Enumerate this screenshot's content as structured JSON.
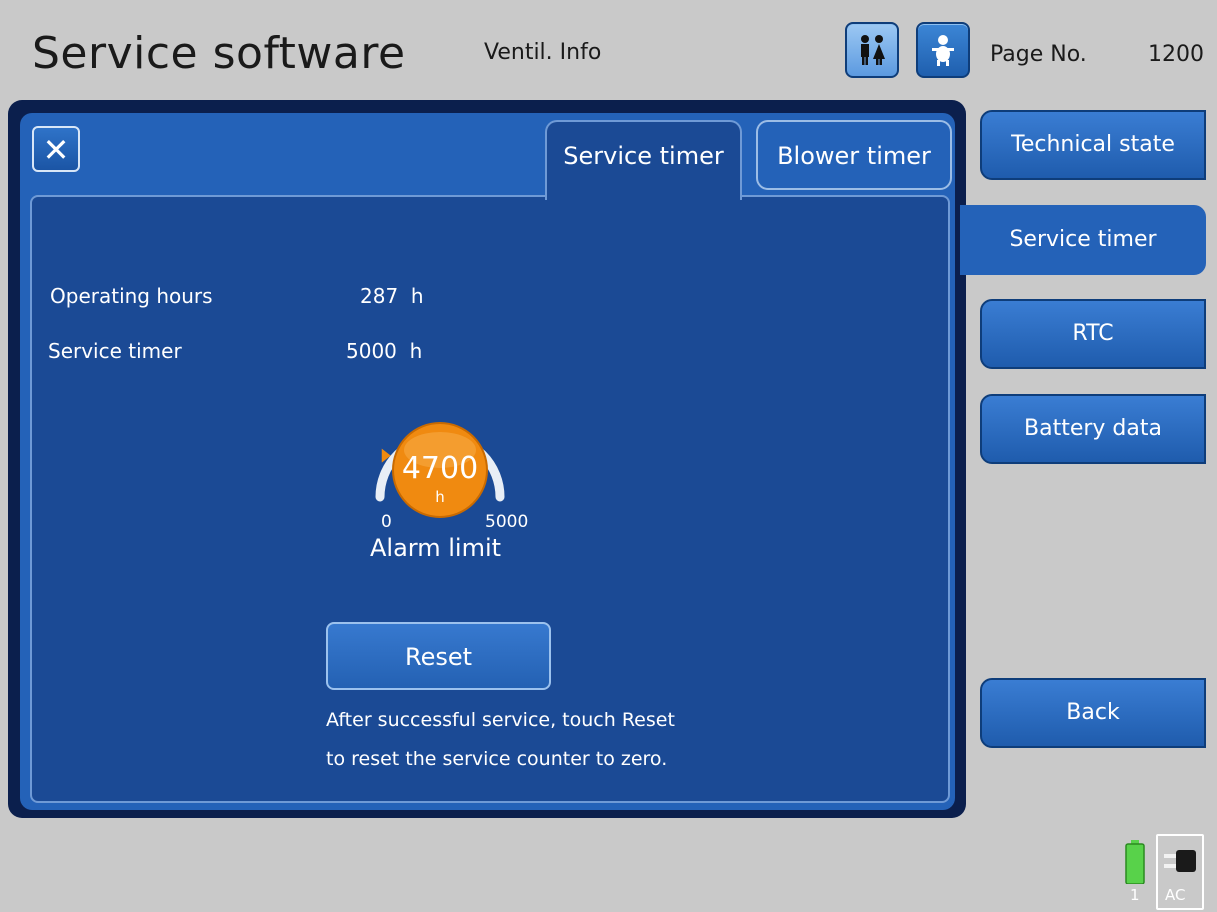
{
  "header": {
    "title": "Service software",
    "screen": "Ventil. Info",
    "page_no_label": "Page No.",
    "page_no_value": "1200",
    "mode_icons": [
      "adult-patient-icon",
      "infant-patient-icon"
    ]
  },
  "tabs": [
    {
      "label": "Service timer",
      "active": true
    },
    {
      "label": "Blower timer",
      "active": false
    }
  ],
  "content": {
    "operating_hours_label": "Operating hours",
    "operating_hours_value": "287  h",
    "service_timer_label": "Service timer",
    "service_timer_value": "5000  h",
    "gauge": {
      "value": "4700",
      "unit": "h",
      "min": "0",
      "max": "5000",
      "label": "Alarm limit",
      "fraction": 0.94
    },
    "reset_label": "Reset",
    "hint_line_1": "After successful service, touch Reset",
    "hint_line_2": "to reset the service counter to zero."
  },
  "nav": {
    "technical_state": "Technical state",
    "service_timer": "Service timer",
    "rtc": "RTC",
    "battery_data": "Battery data",
    "back": "Back"
  },
  "status": {
    "battery_number": "1",
    "ac_label": "AC"
  },
  "colors": {
    "panel_blue": "#2462b8",
    "content_blue": "#1b4a95",
    "accent_orange": "#f08a10",
    "battery_green": "#58d24a"
  }
}
